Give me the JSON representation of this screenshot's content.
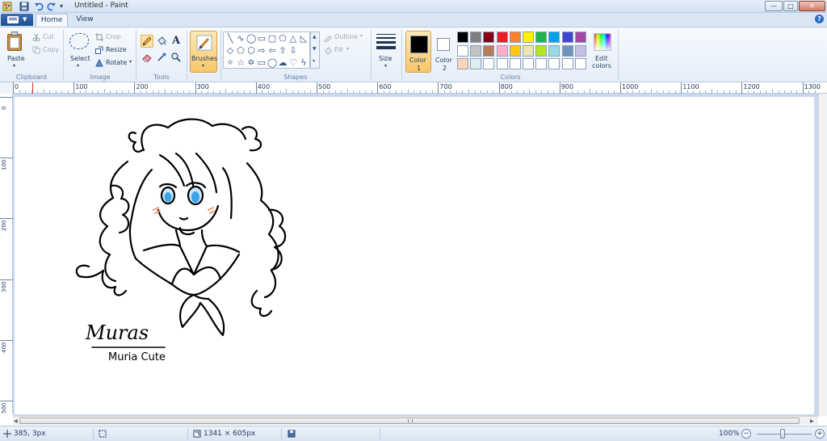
{
  "window": {
    "title": "Untitled - Paint",
    "min": "—",
    "max": "□",
    "close": "✕"
  },
  "tabs": [
    {
      "label": "Home",
      "active": true
    },
    {
      "label": "View",
      "active": false
    }
  ],
  "help": "?",
  "ribbon": {
    "clipboard": {
      "group": "Clipboard",
      "paste": "Paste",
      "cut": "Cut",
      "copy": "Copy"
    },
    "image": {
      "group": "Image",
      "select": "Select",
      "crop": "Crop",
      "resize": "Resize",
      "rotate": "Rotate"
    },
    "tools": {
      "group": "Tools",
      "text_tool": "A"
    },
    "brushes": {
      "label": "Brushes"
    },
    "shapes": {
      "group": "Shapes",
      "outline": "Outline",
      "fill": "Fill"
    },
    "size": {
      "label": "Size"
    },
    "colors": {
      "group": "Colors",
      "color1": {
        "label": "Color",
        "num": "1",
        "value": "#000000"
      },
      "color2": {
        "label": "Color",
        "num": "2",
        "value": "#ffffff"
      },
      "edit_label_1": "Edit",
      "edit_label_2": "colors",
      "palette_row1": [
        "#000000",
        "#7f7f7f",
        "#880015",
        "#ed1c24",
        "#ff7f27",
        "#fff200",
        "#22b14c",
        "#00a2e8",
        "#3f48cc",
        "#a349a4"
      ],
      "palette_row2": [
        "#ffffff",
        "#c3c3c3",
        "#b97a57",
        "#ffaec9",
        "#ffc90e",
        "#efe4b0",
        "#b5e61d",
        "#99d9ea",
        "#7092be",
        "#c8bfe7"
      ],
      "palette_row3": [
        "#fbd5b5",
        "#dcefef",
        "#ffffff",
        "#ffffff",
        "#ffffff",
        "#ffffff",
        "#ffffff",
        "#ffffff",
        "#ffffff",
        "#ffffff"
      ]
    }
  },
  "ruler": {
    "h_ticks": [
      "0",
      "100",
      "200",
      "300",
      "400",
      "500",
      "600",
      "700",
      "800",
      "900",
      "1000",
      "1100",
      "1200",
      "1300"
    ],
    "v_ticks": [
      "0",
      "100",
      "200",
      "300",
      "400",
      "500"
    ]
  },
  "drawing": {
    "signature_top": "Muras",
    "signature_bottom": "Muria Cute"
  },
  "status": {
    "cursor": "385, 3px",
    "canvas_size": "1341 × 605px",
    "zoom": "100%",
    "zoom_out": "−",
    "zoom_in": "+"
  }
}
